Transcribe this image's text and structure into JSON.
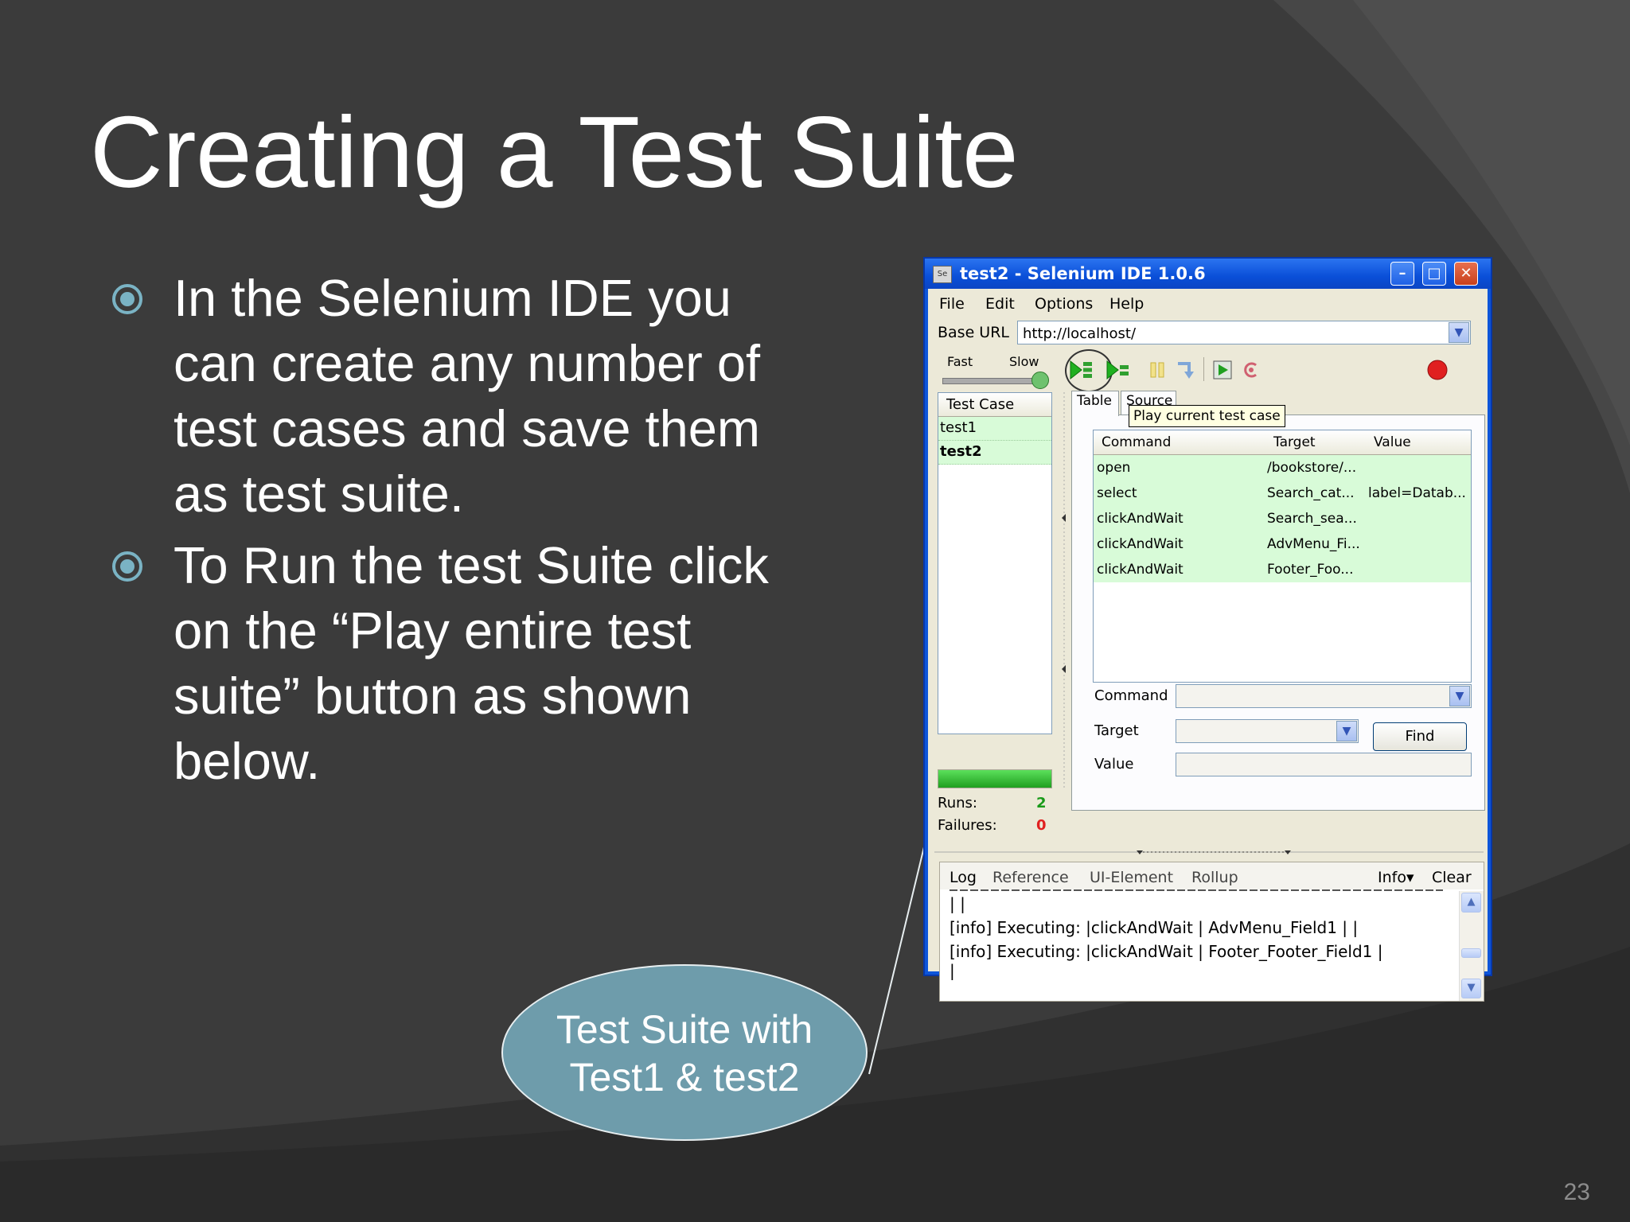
{
  "slide": {
    "title": "Creating a Test Suite",
    "bullets": [
      "In the Selenium IDE you can create any number of test cases and save them as test suite.",
      "To Run the test Suite click on the “Play entire test suite” button as shown below."
    ],
    "callout_line1": "Test Suite with",
    "callout_line2": "Test1 &  test2",
    "page_number": "23",
    "colors": {
      "background": "#3b3b3b",
      "title": "#ffffff",
      "bullet_icon": "#7ab3c4",
      "callout": "#6e9cab"
    }
  },
  "ide": {
    "window_title": "test2 - Selenium IDE 1.0.6",
    "app_icon": "Se",
    "menu": [
      "File",
      "Edit",
      "Options",
      "Help"
    ],
    "base_url_label": "Base URL",
    "base_url_value": "http://localhost/",
    "speed": {
      "fast_label": "Fast",
      "slow_label": "Slow"
    },
    "toolbar_icons": [
      "play-entire-suite-icon",
      "play-current-test-icon",
      "pause-icon",
      "step-icon",
      "testrunner-icon",
      "rollup-icon",
      "record-icon"
    ],
    "test_case_header": "Test Case",
    "test_cases": [
      "test1",
      "test2"
    ],
    "runs_label": "Runs:",
    "runs_value": "2",
    "failures_label": "Failures:",
    "failures_value": "0",
    "tabs": [
      "Table",
      "Source"
    ],
    "tooltip": "Play current test case",
    "grid_headers": [
      "Command",
      "Target",
      "Value"
    ],
    "grid_rows": [
      [
        "open",
        "/bookstore/...",
        ""
      ],
      [
        "select",
        "Search_cat...",
        "label=Datab..."
      ],
      [
        "clickAndWait",
        "Search_sea...",
        ""
      ],
      [
        "clickAndWait",
        "AdvMenu_Fi...",
        ""
      ],
      [
        "clickAndWait",
        "Footer_Foo...",
        ""
      ]
    ],
    "command_label": "Command",
    "target_label": "Target",
    "value_label": "Value",
    "find_label": "Find",
    "log_tabs": [
      "Log",
      "Reference",
      "UI-Element",
      "Rollup"
    ],
    "info_label": "Info▾",
    "clear_label": "Clear",
    "log_lines": [
      "| |",
      "[info] Executing: |clickAndWait | AdvMenu_Field1 | |",
      "[info] Executing: |clickAndWait | Footer_Footer_Field1 |",
      "|"
    ]
  }
}
